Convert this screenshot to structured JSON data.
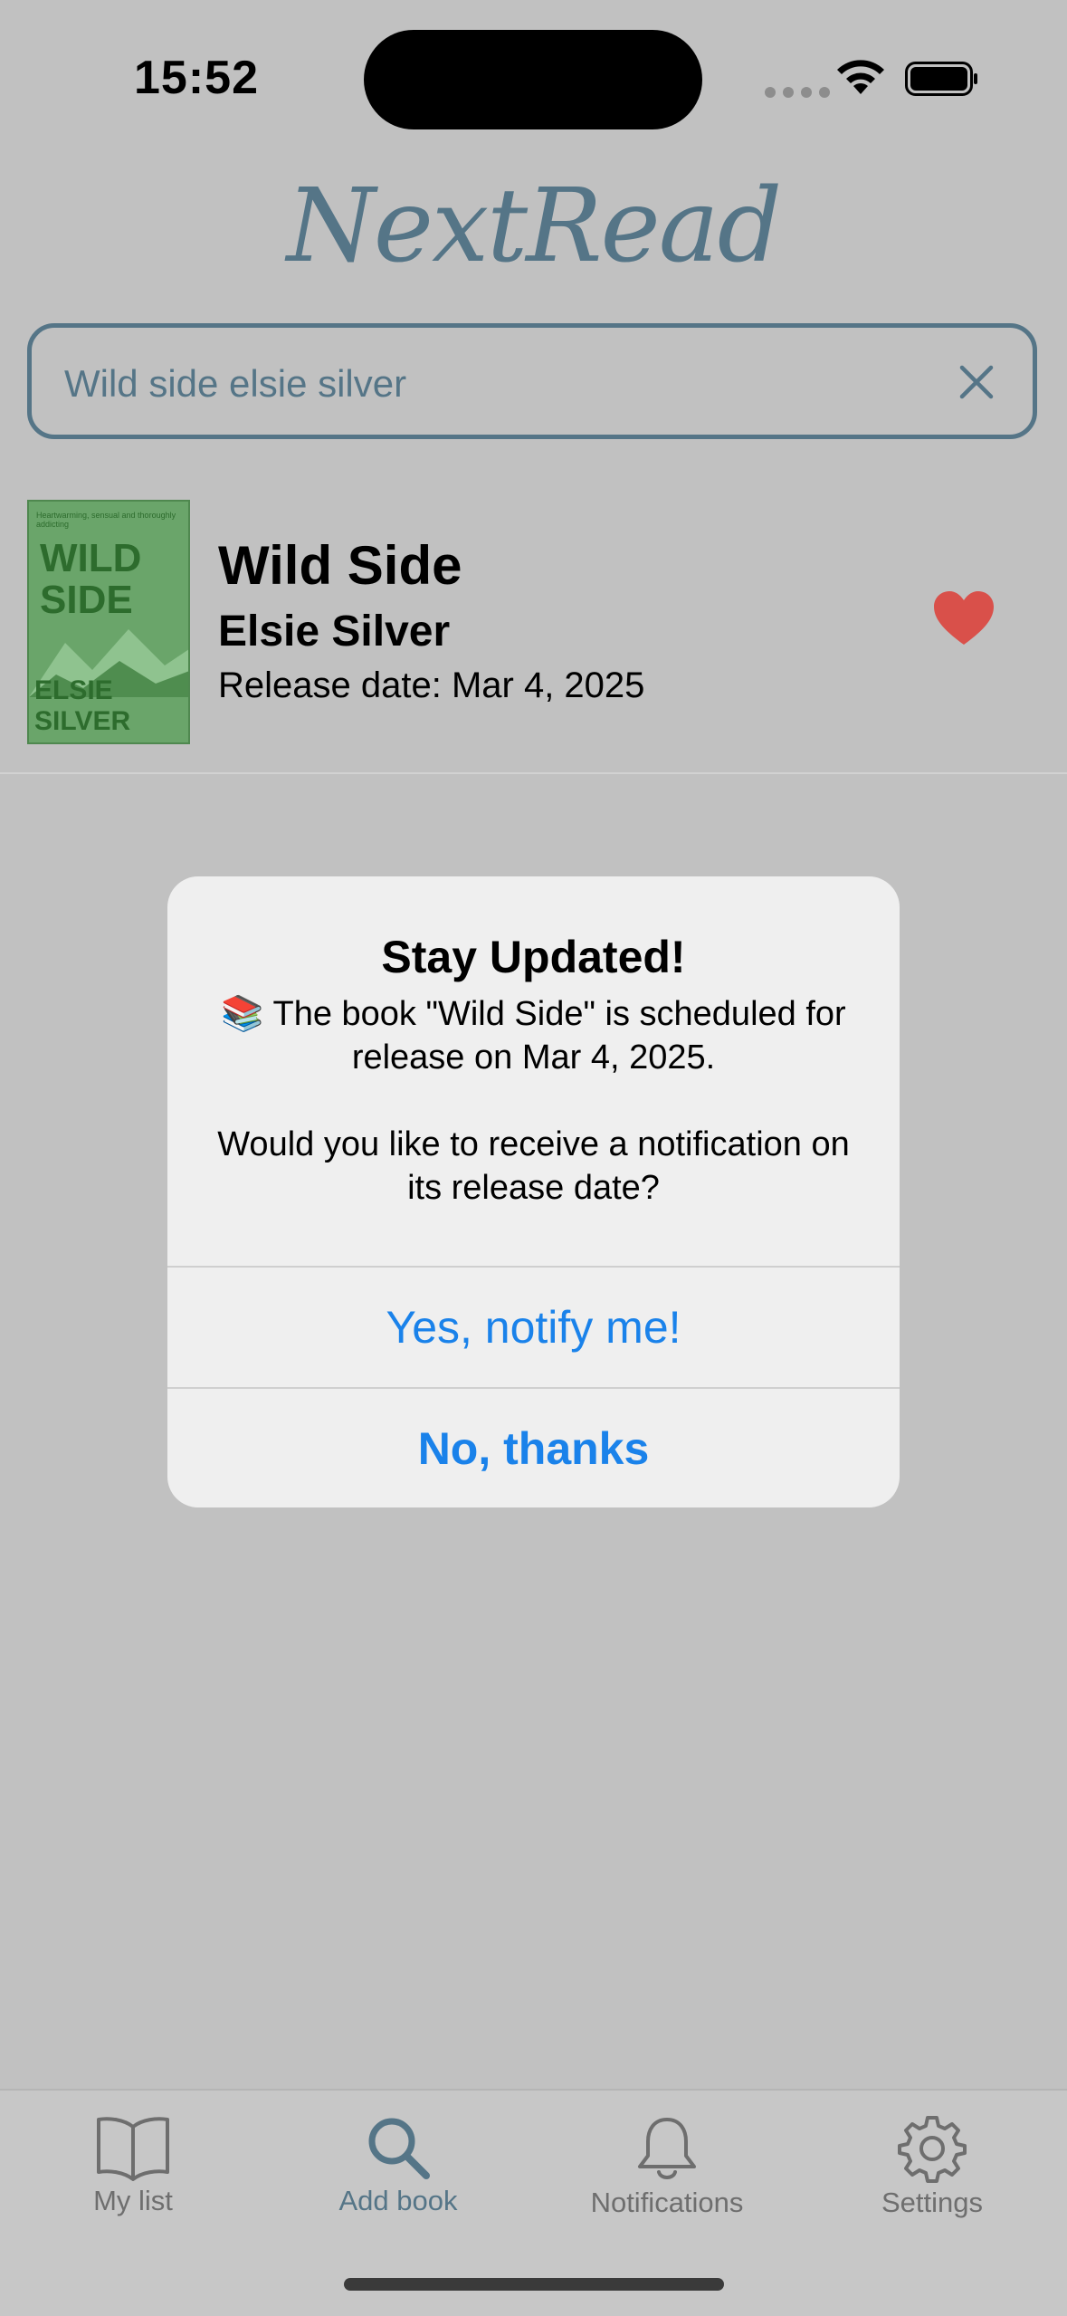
{
  "status_bar": {
    "time": "15:52"
  },
  "app": {
    "logo_text": "NextRead"
  },
  "search": {
    "value": "Wild side elsie silver"
  },
  "result": {
    "cover_blurb": "Heartwarming, sensual and thoroughly addicting",
    "cover_title_line1": "WILD",
    "cover_title_line2": "SIDE",
    "cover_author": "ELSIE SILVER",
    "title": "Wild Side",
    "author": "Elsie Silver",
    "release": "Release date: Mar 4, 2025",
    "favorite_color": "#d9504a"
  },
  "dialog": {
    "title": "Stay Updated!",
    "message_line1": "📚 The book \"Wild Side\" is scheduled for release on Mar 4, 2025.",
    "message_line2": "Would you like to receive a notification on its release date?",
    "confirm_label": "Yes, notify me!",
    "cancel_label": "No, thanks"
  },
  "tabs": [
    {
      "label": "My list",
      "icon": "book-icon"
    },
    {
      "label": "Add book",
      "icon": "search-icon",
      "active": true
    },
    {
      "label": "Notifications",
      "icon": "bell-icon"
    },
    {
      "label": "Settings",
      "icon": "gear-icon"
    }
  ],
  "colors": {
    "accent": "#557587",
    "dialog_button": "#1a82ea"
  }
}
